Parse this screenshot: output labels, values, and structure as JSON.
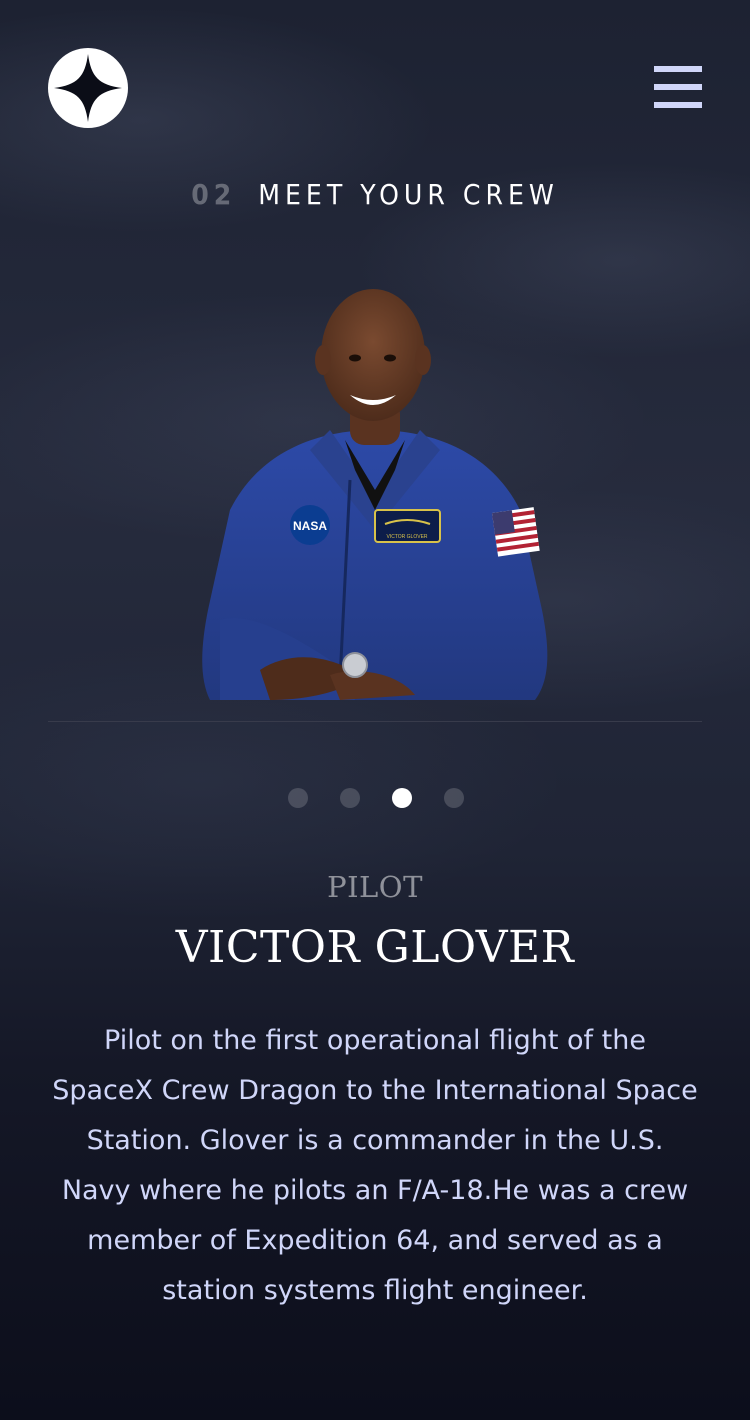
{
  "header": {
    "logo_icon": "star-logo-icon",
    "menu_icon": "hamburger-menu-icon"
  },
  "page": {
    "number": "02",
    "title": "MEET YOUR CREW"
  },
  "crew": {
    "active_index": 2,
    "total": 4,
    "role": "PILOT",
    "name": "VICTOR GLOVER",
    "bio": "Pilot on the first operational flight of the SpaceX Crew Dragon to the International Space Station. Glover is a commander in the U.S. Navy where he pilots an F/A-18.He was a crew member of Expedition 64, and served as a station systems flight engineer."
  },
  "photo": {
    "patch_nasa": "NASA",
    "badge_name": "VICTOR GLOVER"
  },
  "colors": {
    "background": "#0b0d17",
    "accent": "#d0d6f9",
    "white": "#ffffff"
  }
}
